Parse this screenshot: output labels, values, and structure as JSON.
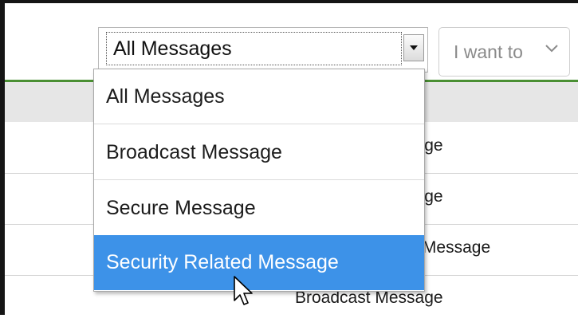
{
  "filter": {
    "selected": "All Messages",
    "options": [
      "All Messages",
      "Broadcast Message",
      "Secure Message",
      "Security Related Message"
    ],
    "highlighted_index": 3
  },
  "actions": {
    "i_want_to_label": "I want to"
  },
  "grid": {
    "rows": [
      {
        "type": "Broadcast Message"
      },
      {
        "type": "Broadcast Message"
      },
      {
        "type": "Security Related Message"
      },
      {
        "type": "Broadcast Message"
      }
    ]
  },
  "colors": {
    "accent_rule": "#4a8f33",
    "selection": "#3d92e8"
  }
}
